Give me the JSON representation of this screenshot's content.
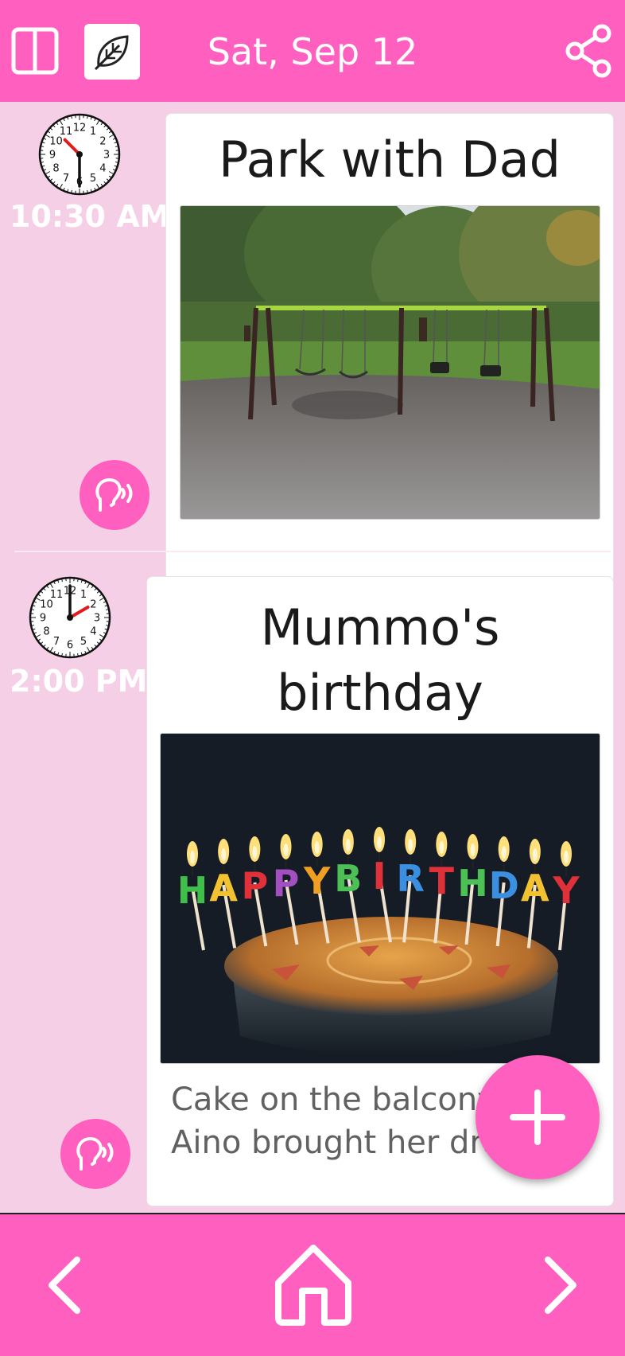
{
  "header": {
    "date": "Sat, Sep 12",
    "split_view_icon": "split-view-icon",
    "leaf_icon": "leaf-icon",
    "share_icon": "share-icon"
  },
  "events": [
    {
      "time": "10:30 AM",
      "title": "Park with Dad",
      "photo": "playground swings in a park",
      "description": ""
    },
    {
      "time": "2:00 PM",
      "title_lines": [
        "Mummo's",
        "birthday"
      ],
      "photo": "birthday cake with HAPPY BIRTHDAY candles",
      "candle_text": "HAPPY BIRTHDAY",
      "description_lines": [
        "Cake on the balcony",
        "Aino brought her dra"
      ]
    }
  ],
  "clock_numbers": [
    "12",
    "1",
    "2",
    "3",
    "4",
    "5",
    "6",
    "7",
    "8",
    "9",
    "10",
    "11"
  ],
  "fab_icon": "plus-icon",
  "footer": {
    "prev_icon": "chevron-left-icon",
    "home_icon": "home-icon",
    "next_icon": "chevron-right-icon"
  },
  "colors": {
    "accent": "#ff5fbe",
    "background": "#f5cfe6",
    "hand_red": "#e01b1b"
  }
}
